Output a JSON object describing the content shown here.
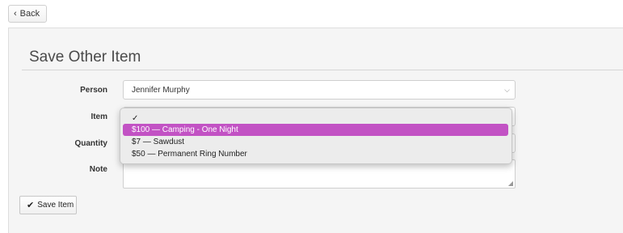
{
  "back_button": {
    "label": "Back",
    "icon": "chevron-left-icon"
  },
  "form": {
    "title": "Save Other Item",
    "person": {
      "label": "Person",
      "value": "Jennifer Murphy"
    },
    "item": {
      "label": "Item",
      "options": [
        {
          "text": "✓",
          "selected": false
        },
        {
          "text": "$100 — Camping - One Night",
          "selected": true
        },
        {
          "text": "$7 — Sawdust",
          "selected": false
        },
        {
          "text": "$50 — Permanent Ring Number",
          "selected": false
        }
      ]
    },
    "quantity": {
      "label": "Quantity"
    },
    "note": {
      "label": "Note"
    },
    "save_button": {
      "label": "Save Item",
      "icon": "checkmark-icon"
    }
  },
  "colors": {
    "highlight": "#c252c4",
    "panel_bg": "#f5f5f5"
  }
}
